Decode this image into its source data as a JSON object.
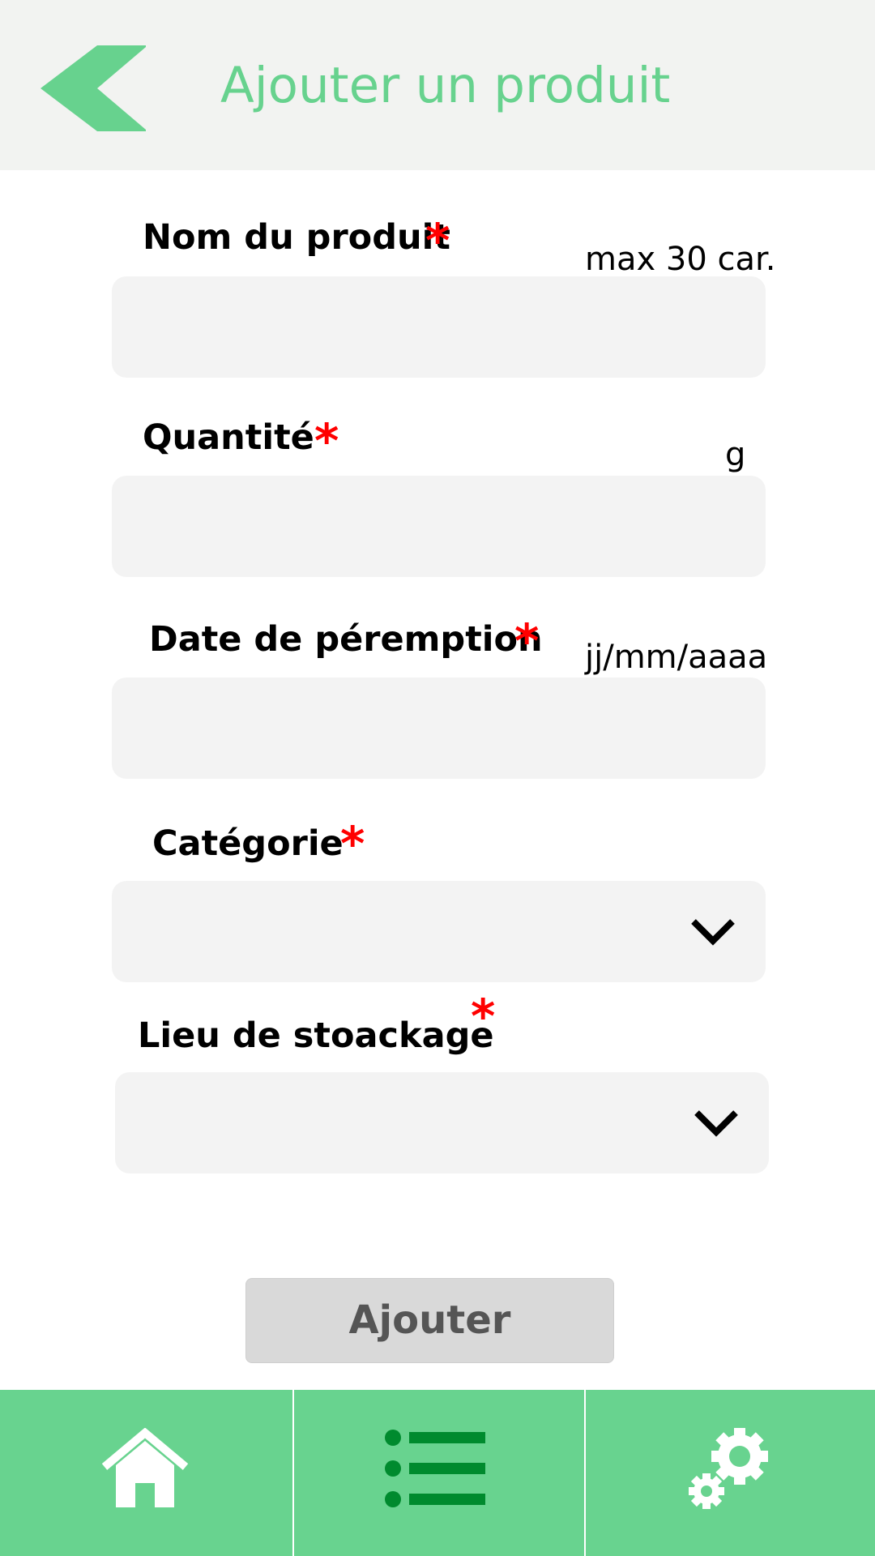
{
  "header": {
    "title": "Ajouter un produit",
    "back_icon": "chevron-left-icon"
  },
  "form": {
    "name": {
      "label": "Nom du produit",
      "required": "*",
      "hint": "max 30 car.",
      "value": ""
    },
    "quantity": {
      "label": "Quantité",
      "required": "*",
      "unit": "g",
      "value": ""
    },
    "expiry": {
      "label": "Date de péremption",
      "required": "*",
      "hint": "jj/mm/aaaa",
      "value": ""
    },
    "category": {
      "label": "Catégorie",
      "required": "*",
      "value": ""
    },
    "storage": {
      "label": "Lieu de stoackage",
      "required": "*",
      "value": ""
    },
    "submit_label": "Ajouter"
  },
  "navbar": {
    "items": [
      {
        "icon": "home-icon"
      },
      {
        "icon": "list-icon",
        "active": true
      },
      {
        "icon": "gears-icon"
      }
    ]
  },
  "colors": {
    "accent": "#68d38f",
    "active_icon": "#008a2e",
    "required": "#ff0000",
    "field_bg": "#f3f3f3",
    "header_bg": "#f2f3f1"
  }
}
